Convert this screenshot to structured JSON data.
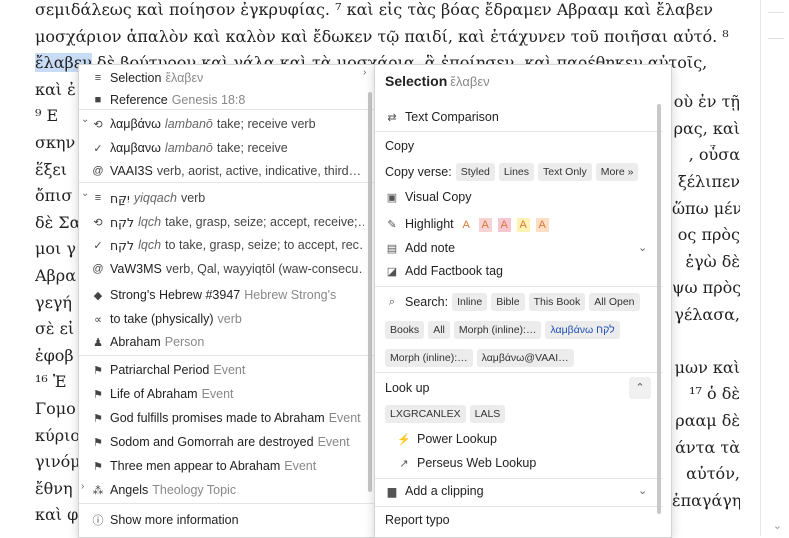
{
  "doc_lines": [
    {
      "text": "σεμιδάλεως καὶ ποίησον ἐγκρυφίας. ⁷ καὶ εἰς τὰς βόας ἔδραμεν Αβρααμ καὶ ἔλαβεν"
    },
    {
      "text": "μοσχάριον ἁπαλὸν καὶ καλὸν καὶ ἔδωκεν τῷ παιδί, καὶ ἐτάχυνεν τοῦ ποιῆσαι αὐτό. ⁸"
    },
    {
      "hl": "ἔλαβεν",
      "rest": " δὲ βούτυρον καὶ γάλα καὶ τὰ μοσχάρια, ἃ ἐποίησεν, καὶ παρέθηκεν αὐτοῖς,"
    },
    {
      "text": "καὶ ἐ"
    },
    {
      "text": "  ⁹ Ε"
    },
    {
      "text": "σκην"
    },
    {
      "text": "ἕξει"
    },
    {
      "text": "ὄπισ"
    },
    {
      "text": "δὲ Σα"
    },
    {
      "text": "μοι γ"
    },
    {
      "text": "Αβρα"
    },
    {
      "text": "γεγή"
    },
    {
      "text": "σὲ εἰ"
    },
    {
      "text": "ἐφοβ"
    },
    {
      "text": "  ¹⁶ Ἐ"
    },
    {
      "text": "Γομο"
    },
    {
      "text": "κύριο"
    },
    {
      "text": "γινόμ"
    },
    {
      "text": "ἔθνη"
    },
    {
      "text": "καὶ φ"
    }
  ],
  "doc_right": [
    "οὺ ἐν τῇ",
    "ρας, καὶ",
    ", οὖσα",
    "ξέλιπεν",
    "ὥπω μέν",
    "ος πρὸς",
    "ἐγὼ δὲ",
    "ψω πρὸς",
    "γέλασα,",
    "",
    "μων καὶ",
    "¹⁷ ὁ δὲ",
    "ρααμ δὲ",
    "άντα τὰ",
    "αὐτόν,",
    "ἐπαγάγη"
  ],
  "menu": {
    "items": [
      {
        "icon": "≡",
        "icon_name": "list-icon",
        "label": "Selection",
        "sub": "ἔλαβεν",
        "sub_style": "gr"
      },
      {
        "icon": "■",
        "icon_name": "bookmark-icon",
        "label": "Reference",
        "sub": "Genesis 18:8",
        "sub_style": "gr"
      },
      {
        "icon": "⟲",
        "icon_name": "lemma-icon",
        "label": "λαμβάνω",
        "sub": "lambanō",
        "sub_style": "it",
        "desc": "take; receive verb"
      },
      {
        "icon": "✓",
        "icon_name": "check-icon",
        "label": "λαμβανω",
        "sub": "lambanō",
        "sub_style": "it",
        "desc": "take; receive"
      },
      {
        "icon": "@",
        "icon_name": "morph-icon",
        "label": "VAAI3S",
        "desc": "verb, aorist, active, indicative, third…"
      },
      {
        "icon": "≡",
        "icon_name": "list-icon",
        "label": "יִקַּח",
        "sub": "yiqqach",
        "sub_style": "it",
        "desc": "verb"
      },
      {
        "icon": "⟲",
        "icon_name": "lemma-icon",
        "label": "לקח",
        "sub": "lqch",
        "sub_style": "it",
        "desc": "take, grasp, seize; accept, receive;…"
      },
      {
        "icon": "✓",
        "icon_name": "check-icon",
        "label": "לקח",
        "sub": "lqch",
        "sub_style": "it",
        "desc": "to take, grasp, seize; to accept, rec…"
      },
      {
        "icon": "@",
        "icon_name": "morph-icon",
        "label": "VaW3MS",
        "desc": "verb, Qal, wayyiqtōl (waw-consecu…"
      },
      {
        "icon": "◆",
        "icon_name": "strongs-icon",
        "label": "Strong's Hebrew #3947",
        "sub": "Hebrew Strong's",
        "sub_style": "gr"
      },
      {
        "icon": "∝",
        "icon_name": "sense-icon",
        "label": "to take (physically)",
        "sub": "verb",
        "sub_style": "gr"
      },
      {
        "icon": "♟",
        "icon_name": "person-icon",
        "label": "Abraham",
        "sub": "Person",
        "sub_style": "gr"
      },
      {
        "icon": "⚑",
        "icon_name": "event-flag-icon",
        "label": "Patriarchal Period",
        "sub": "Event",
        "sub_style": "gr"
      },
      {
        "icon": "⚑",
        "icon_name": "event-flag-icon",
        "label": "Life of Abraham",
        "sub": "Event",
        "sub_style": "gr"
      },
      {
        "icon": "⚑",
        "icon_name": "event-flag-icon",
        "label": "God fulfills promises made to Abraham",
        "sub": "Event",
        "sub_style": "gr"
      },
      {
        "icon": "⚑",
        "icon_name": "event-flag-icon",
        "label": "Sodom and Gomorrah are destroyed",
        "sub": "Event",
        "sub_style": "gr"
      },
      {
        "icon": "⚑",
        "icon_name": "event-flag-icon",
        "label": "Three men appear to Abraham",
        "sub": "Event",
        "sub_style": "gr"
      },
      {
        "icon": "⁂",
        "icon_name": "topic-icon",
        "label": "Angels",
        "sub": "Theology Topic",
        "sub_style": "gr"
      },
      {
        "icon": "ⓘ",
        "icon_name": "info-icon",
        "label": "Show more information"
      }
    ]
  },
  "panel": {
    "title": "Selection",
    "title_word": "ἔλαβεν",
    "text_comparison": "Text Comparison",
    "copy": "Copy",
    "copy_verse": "Copy verse:",
    "copy_chips": [
      "Styled",
      "Lines",
      "Text Only",
      "More »"
    ],
    "visual_copy": "Visual Copy",
    "highlight": "Highlight",
    "highlight_swatches": [
      {
        "glyph": "A",
        "bg": "#ffffff"
      },
      {
        "glyph": "A",
        "bg": "#f6d3d3"
      },
      {
        "glyph": "A",
        "bg": "#f7c7d1"
      },
      {
        "glyph": "A",
        "bg": "#fff2b3"
      },
      {
        "glyph": "A",
        "bg": "#fde0c4"
      }
    ],
    "add_note": "Add note",
    "add_factbook": "Add Factbook tag",
    "search": "Search:",
    "search_chips_1": [
      "Inline",
      "Bible",
      "This Book",
      "All Open"
    ],
    "search_chips_2": [
      "Books",
      "All",
      "Morph (inline):…",
      "λαμβάνω לקח"
    ],
    "search_chips_3": [
      "Morph (inline):…",
      "λαμβάνω@VAAI…"
    ],
    "look_up": "Look up",
    "lookup_chips": [
      "LXGRCANLEX",
      "LALS"
    ],
    "power_lookup": "Power Lookup",
    "perseus": "Perseus Web Lookup",
    "add_clipping": "Add a clipping",
    "report_typo": "Report typo"
  },
  "colors": {
    "highlight": "#c9dcf5",
    "accent_blue": "#1e4fb5",
    "highlight_orange": "#d9773a"
  }
}
